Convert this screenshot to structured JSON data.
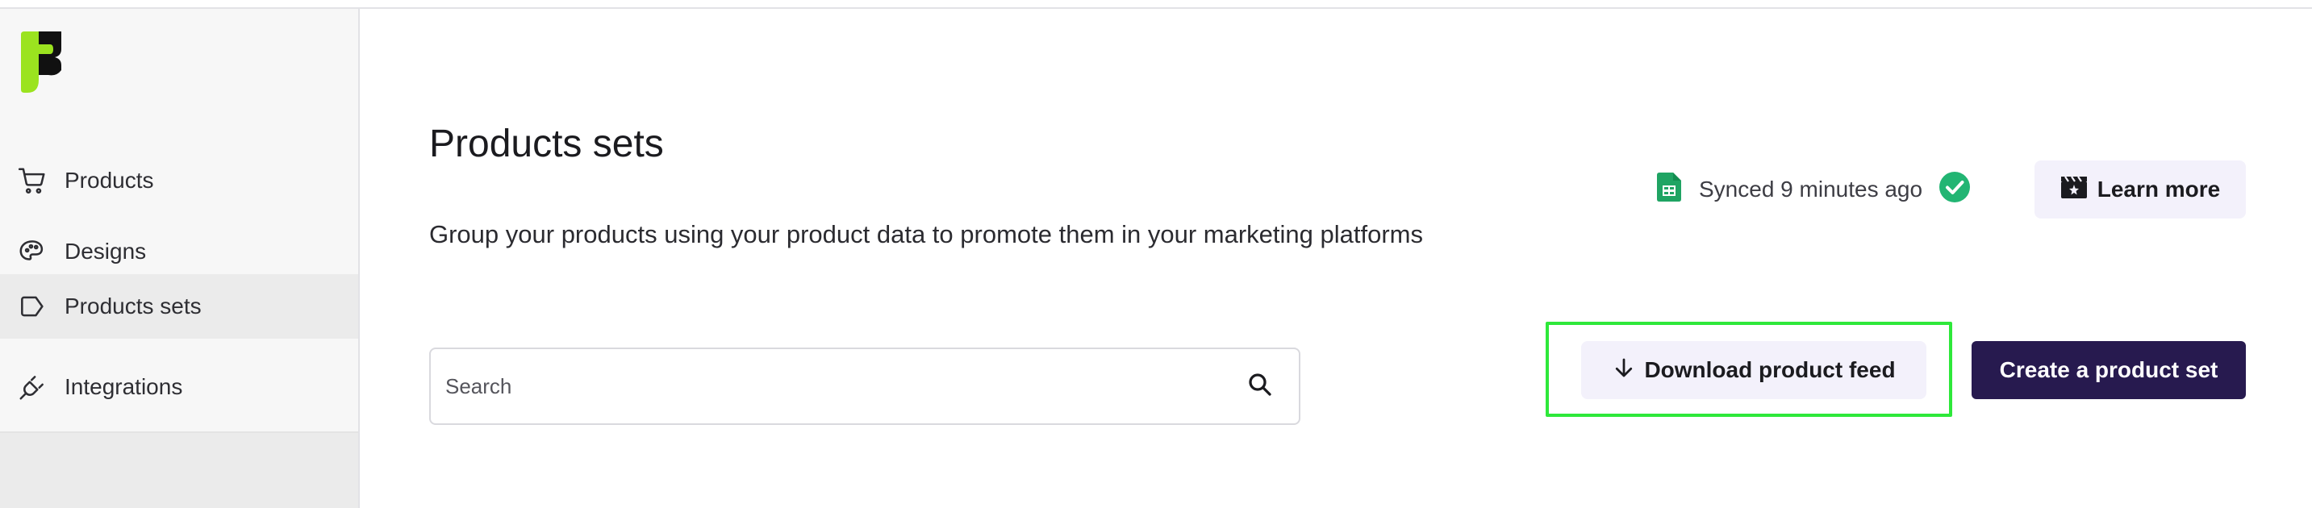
{
  "sidebar": {
    "logo_icon": "brand-logo-icon",
    "items": [
      {
        "label": "Products",
        "icon": "cart-icon"
      },
      {
        "label": "Designs",
        "icon": "palette-icon"
      },
      {
        "label": "Products sets",
        "icon": "tag-icon",
        "active": true
      },
      {
        "label": "Integrations",
        "icon": "plug-icon"
      }
    ]
  },
  "main": {
    "title": "Products sets",
    "subtitle": "Group your products using your product data to promote them in your marketing platforms",
    "sync": {
      "text": "Synced 9 minutes ago",
      "source_icon": "google-sheets-icon",
      "status_icon": "check-circle-icon"
    },
    "learn_more_label": "Learn more",
    "search": {
      "placeholder": "Search",
      "value": ""
    },
    "download_label": "Download product feed",
    "create_label": "Create a product set"
  },
  "colors": {
    "accent_dark": "#271a4f",
    "button_light": "#f3f1fb",
    "logo_green": "#9be31f",
    "success_green": "#22b573",
    "sheets_green": "#1fa463",
    "highlight": "#2ee83a"
  }
}
